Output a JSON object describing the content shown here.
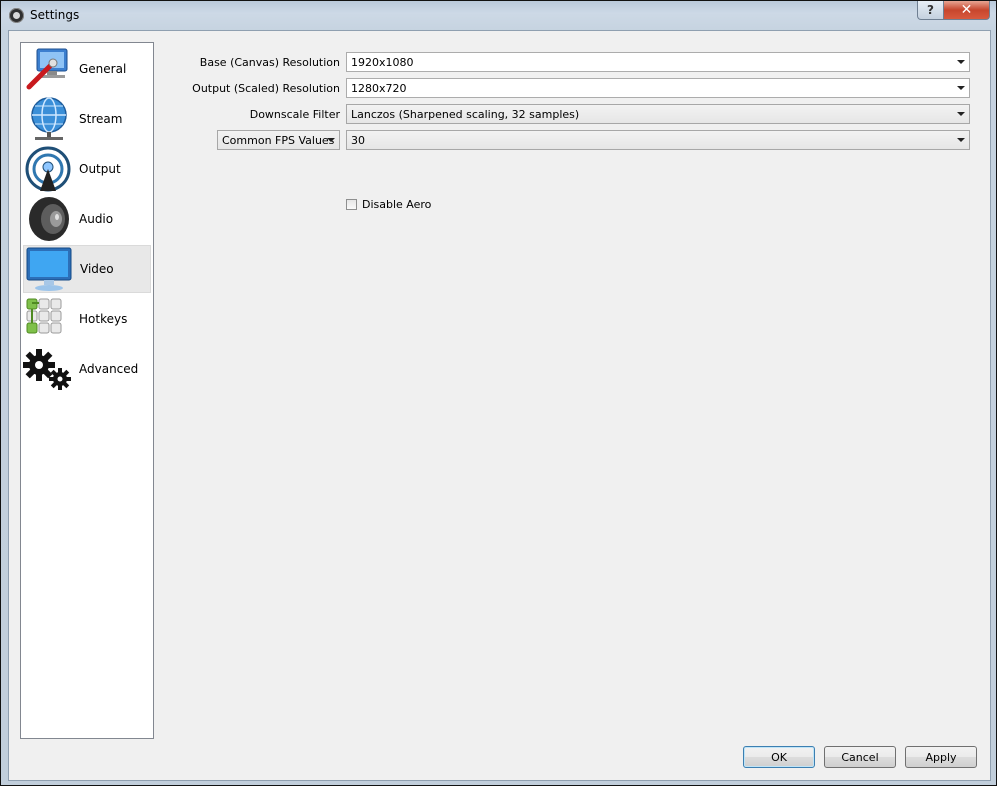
{
  "window": {
    "title": "Settings"
  },
  "caption": {
    "help": "?",
    "close": "✕"
  },
  "sidebar": {
    "items": [
      {
        "label": "General",
        "icon": "general-icon"
      },
      {
        "label": "Stream",
        "icon": "stream-globe-icon"
      },
      {
        "label": "Output",
        "icon": "output-broadcast-icon"
      },
      {
        "label": "Audio",
        "icon": "speaker-icon"
      },
      {
        "label": "Video",
        "icon": "monitor-icon",
        "selected": true
      },
      {
        "label": "Hotkeys",
        "icon": "keyboard-icon"
      },
      {
        "label": "Advanced",
        "icon": "gears-icon"
      }
    ]
  },
  "video": {
    "base_label": "Base (Canvas) Resolution",
    "base_value": "1920x1080",
    "output_label": "Output (Scaled) Resolution",
    "output_value": "1280x720",
    "filter_label": "Downscale Filter",
    "filter_value": "Lanczos (Sharpened scaling, 32 samples)",
    "fps_type_value": "Common FPS Values",
    "fps_value": "30",
    "disable_aero_label": "Disable Aero",
    "disable_aero_checked": false
  },
  "buttons": {
    "ok": "OK",
    "cancel": "Cancel",
    "apply": "Apply"
  },
  "colors": {
    "titlebar": "#c6d3e0",
    "close": "#c7462d",
    "client": "#f0f0f0",
    "default_border": "#3c7fb1"
  }
}
